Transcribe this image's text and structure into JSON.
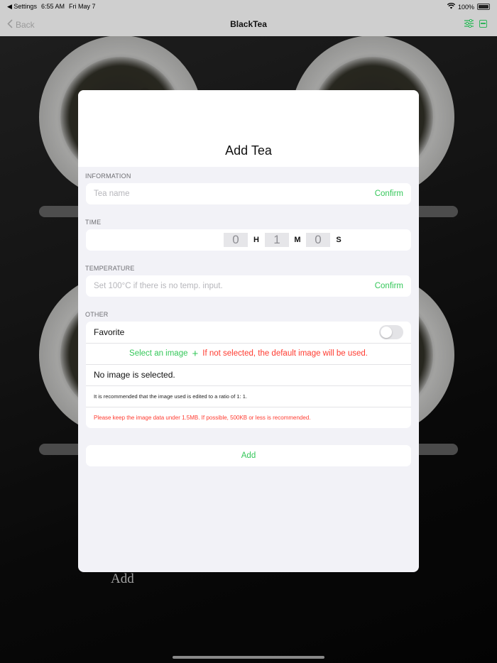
{
  "status_bar": {
    "back_app": "◀ Settings",
    "time": "6:55 AM",
    "date": "Fri May 7",
    "wifi_icon": "wifi-icon",
    "battery": "100%"
  },
  "nav": {
    "back_label": "Back",
    "title": "BlackTea",
    "icons": [
      "sliders-icon",
      "minus-box-icon"
    ]
  },
  "background": {
    "add_label": "Add"
  },
  "sheet": {
    "title": "Add Tea",
    "information": {
      "label": "INFORMATION",
      "name_placeholder": "Tea name",
      "confirm": "Confirm"
    },
    "time": {
      "label": "TIME",
      "hours": "0",
      "h": "H",
      "minutes": "1",
      "m": "M",
      "seconds": "0",
      "s": "S"
    },
    "temperature": {
      "label": "TEMPERATURE",
      "placeholder": "Set 100°C if there is no temp. input.",
      "confirm": "Confirm"
    },
    "other": {
      "label": "OTHER",
      "favorite": "Favorite",
      "favorite_on": false,
      "select_image": "Select an image",
      "default_note": "If not selected, the default image will be used.",
      "no_image": "No image is selected.",
      "ratio_note": "It is recommended that the image used is edited to a ratio of 1: 1.",
      "size_note": "Please keep the image data under 1.5MB. If possible, 500KB or less is recommended."
    },
    "add_button": "Add"
  },
  "colors": {
    "accent": "#34c759",
    "warning": "#ff3b30"
  }
}
